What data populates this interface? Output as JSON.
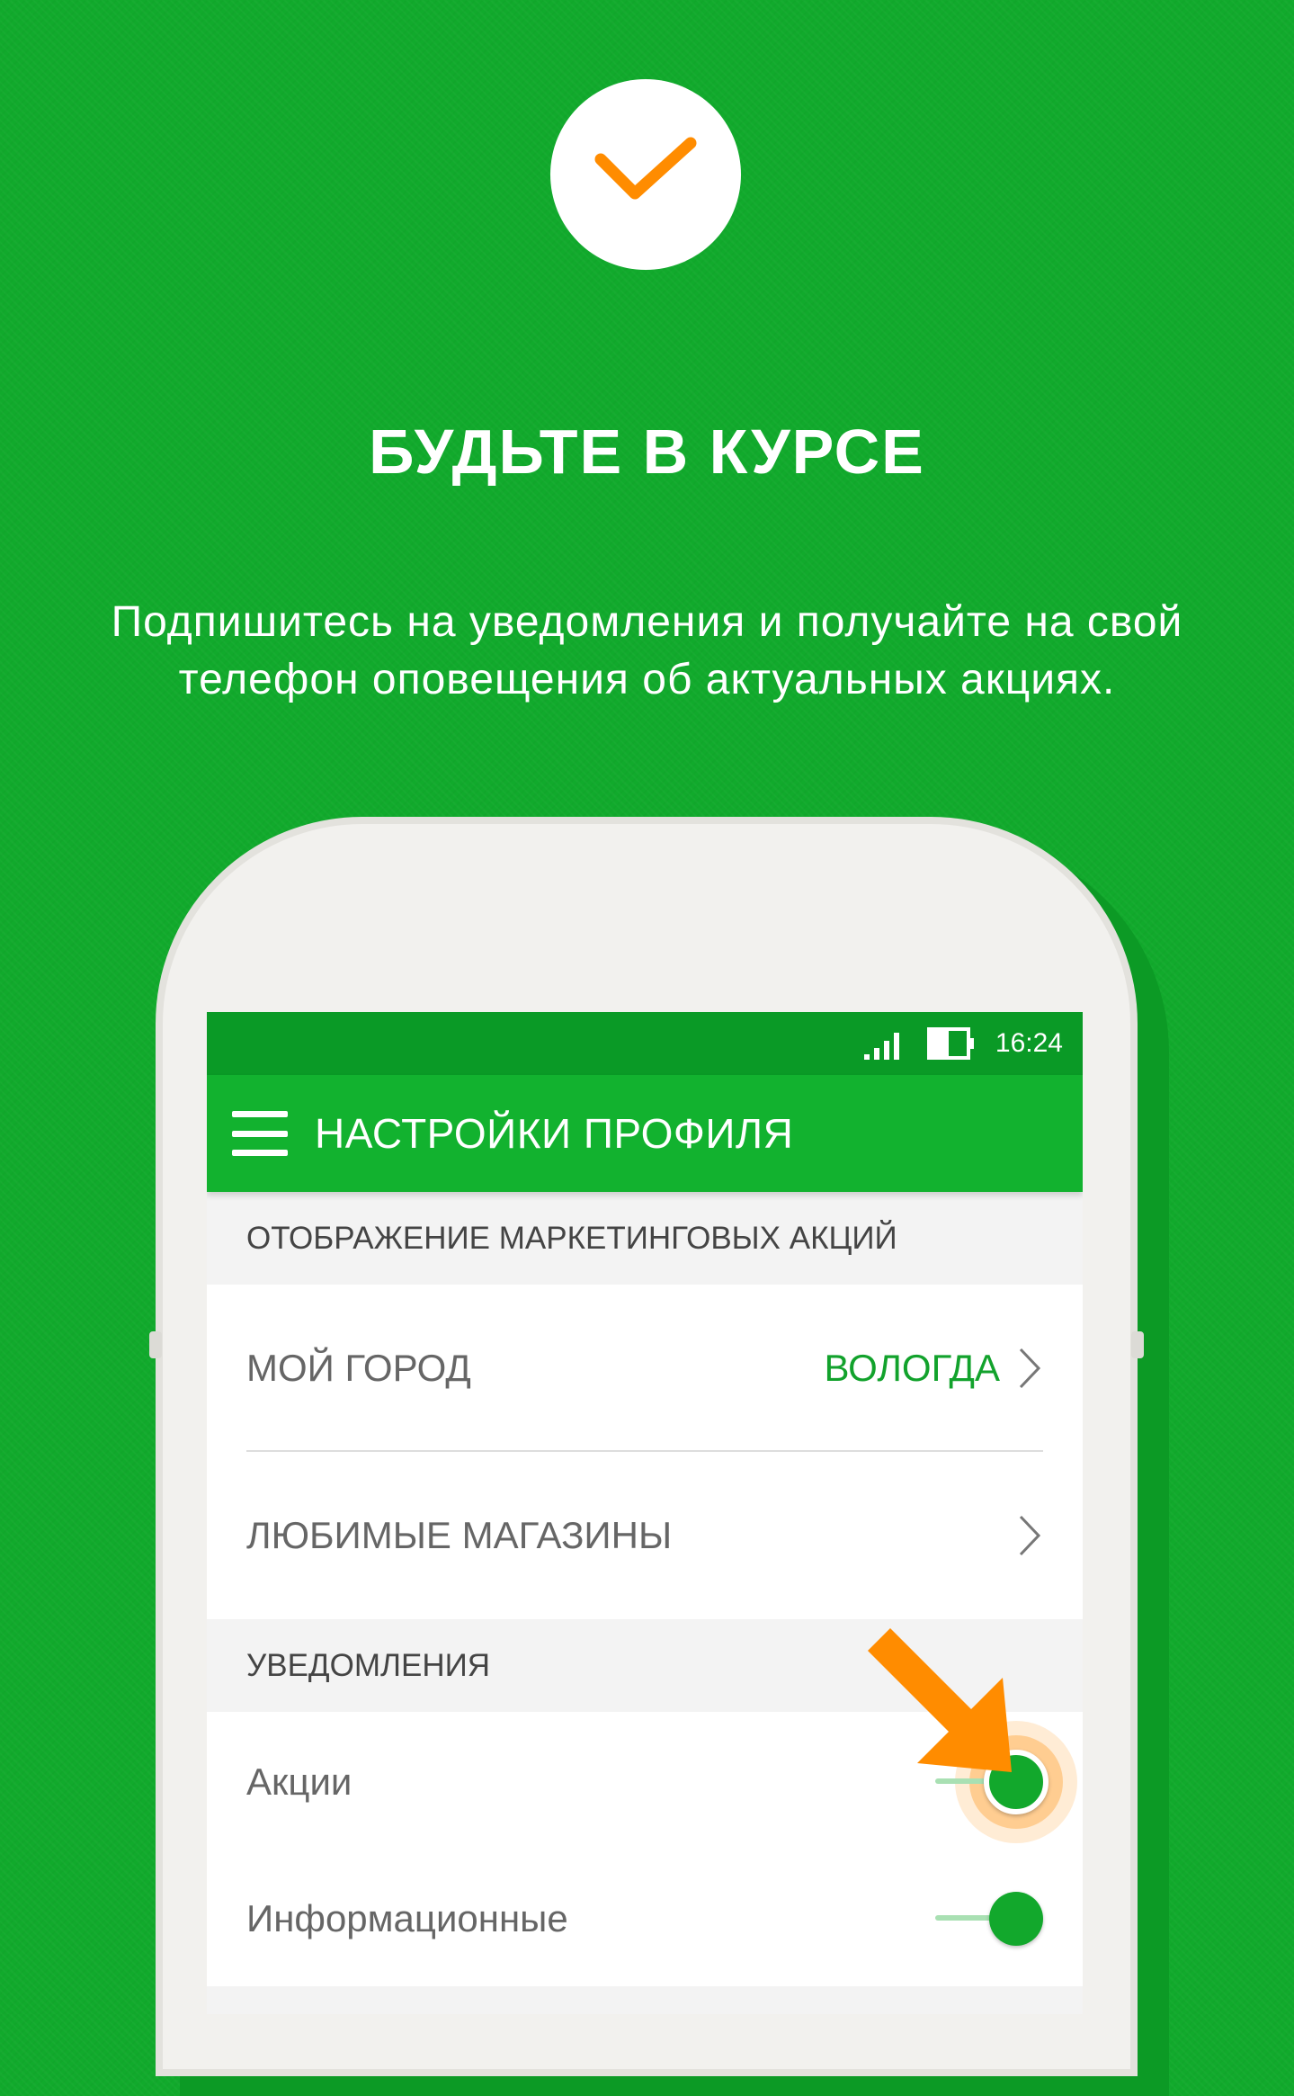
{
  "hero": {
    "headline": "БУДЬТЕ В КУРСЕ",
    "subtext_line1": "Подпишитесь на уведомления и получайте на свой",
    "subtext_line2": "телефон оповещения об актуальных акциях."
  },
  "colors": {
    "background": "#11aa2c",
    "accent_orange": "#ff8c00",
    "app_green": "#12b22f"
  },
  "status_bar": {
    "time": "16:24",
    "icons": [
      "signal-icon",
      "battery-icon"
    ]
  },
  "app_bar": {
    "title": "НАСТРОЙКИ ПРОФИЛЯ",
    "menu_icon": "hamburger-menu-icon"
  },
  "sections": {
    "marketing": {
      "header": "ОТОБРАЖЕНИЕ МАРКЕТИНГОВЫХ АКЦИЙ",
      "city_label": "МОЙ ГОРОД",
      "city_value": "ВОЛОГДА",
      "favorites_label": "ЛЮБИМЫЕ МАГАЗИНЫ"
    },
    "notifications": {
      "header": "УВЕДОМЛЕНИЯ",
      "promos_label": "Акции",
      "promos_enabled": true,
      "info_label": "Информационные",
      "info_enabled": true
    }
  }
}
